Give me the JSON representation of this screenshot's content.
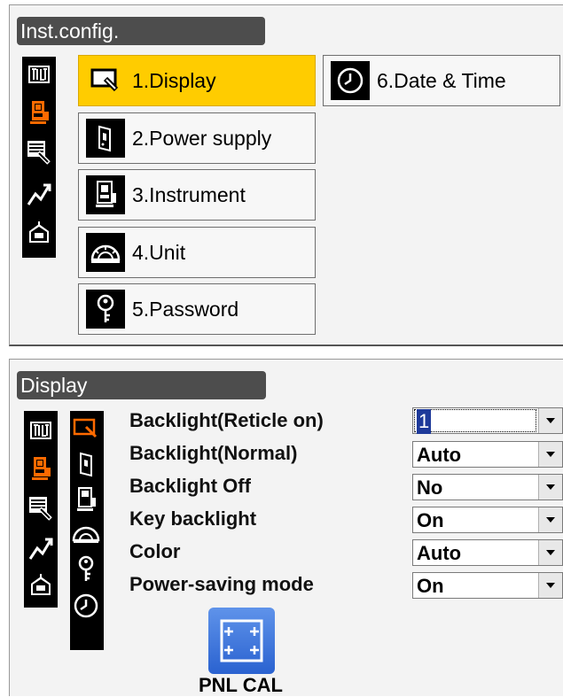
{
  "config_screen": {
    "title": "Inst.config.",
    "side_icons": [
      "observation-mode-icon",
      "instrument-icon",
      "data-keyboard-icon",
      "measure-icon",
      "usb-config-icon"
    ],
    "menu": [
      {
        "label": "1.Display",
        "icon": "display-icon",
        "selected": true
      },
      {
        "label": "2.Power supply",
        "icon": "battery-icon",
        "selected": false
      },
      {
        "label": "3.Instrument",
        "icon": "instrument-icon",
        "selected": false
      },
      {
        "label": "4.Unit",
        "icon": "protractor-icon",
        "selected": false
      },
      {
        "label": "5.Password",
        "icon": "key-icon",
        "selected": false
      },
      {
        "label": "6.Date & Time",
        "icon": "clock-icon",
        "selected": false
      }
    ]
  },
  "display_screen": {
    "title": "Display",
    "settings": [
      {
        "label": "Backlight(Reticle on)",
        "value": "1",
        "active": true
      },
      {
        "label": "Backlight(Normal)",
        "value": "Auto",
        "active": false
      },
      {
        "label": "Backlight Off",
        "value": "No",
        "active": false
      },
      {
        "label": "Key backlight",
        "value": "On",
        "active": false
      },
      {
        "label": "Color",
        "value": "Auto",
        "active": false
      },
      {
        "label": "Power-saving mode",
        "value": "On",
        "active": false
      }
    ],
    "pnl_cal_label": "PNL CAL"
  },
  "colors": {
    "selected_tile": "#ffcc00",
    "title_bar": "#4d4d4d",
    "selection_highlight": "#1e3a9a",
    "pnl_cal_button": "#2f6bd6",
    "accent_orange": "#ff6a00"
  }
}
